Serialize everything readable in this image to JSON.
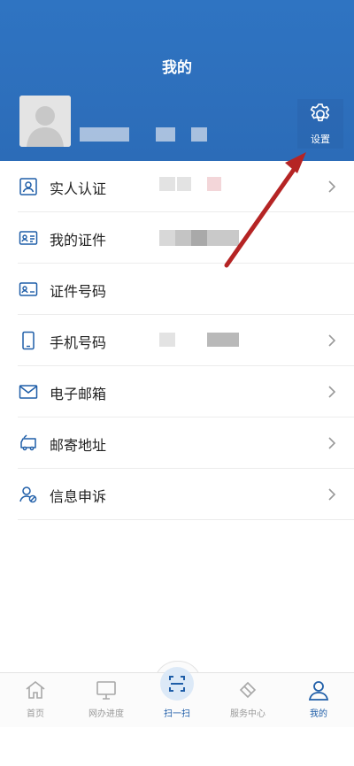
{
  "header": {
    "title": "我的"
  },
  "settings": {
    "label": "设置",
    "icon": "gear-icon"
  },
  "menu": [
    {
      "label": "实人认证",
      "icon": "person-card-icon",
      "chevron": true
    },
    {
      "label": "我的证件",
      "icon": "id-card-icon",
      "chevron": false
    },
    {
      "label": "证件号码",
      "icon": "id-number-icon",
      "chevron": false
    },
    {
      "label": "手机号码",
      "icon": "phone-icon",
      "chevron": true
    },
    {
      "label": "电子邮箱",
      "icon": "mail-icon",
      "chevron": true
    },
    {
      "label": "邮寄地址",
      "icon": "truck-icon",
      "chevron": true
    },
    {
      "label": "信息申诉",
      "icon": "user-appeal-icon",
      "chevron": true
    }
  ],
  "tabs": [
    {
      "label": "首页",
      "icon": "home-icon",
      "active": false
    },
    {
      "label": "网办进度",
      "icon": "monitor-icon",
      "active": false
    },
    {
      "label": "扫一扫",
      "icon": "scan-icon",
      "active": true
    },
    {
      "label": "服务中心",
      "icon": "service-icon",
      "active": false
    },
    {
      "label": "我的",
      "icon": "user-icon",
      "active": true
    }
  ],
  "colors": {
    "header_bg": "#2f74c2",
    "accent": "#1f5ea8",
    "annotation_arrow": "#b52424"
  }
}
